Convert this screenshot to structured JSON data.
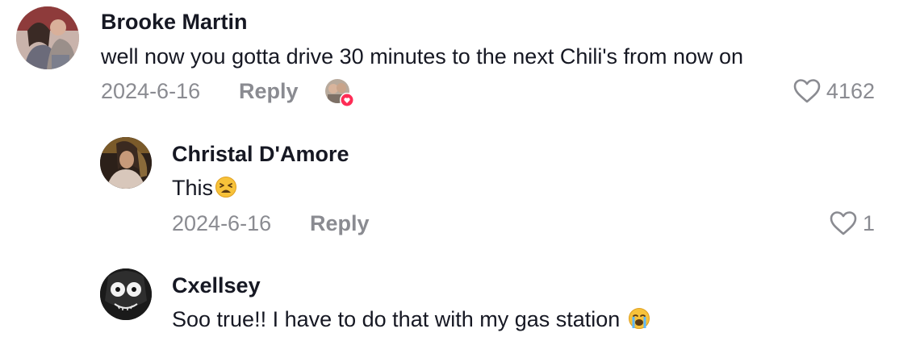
{
  "comments": [
    {
      "username": "Brooke Martin",
      "text": "well now you gotta drive 30 minutes to the next Chili's from now on",
      "date": "2024-6-16",
      "reply_label": "Reply",
      "likes": "4162"
    },
    {
      "username": "Christal D'Amore",
      "text": "This",
      "date": "2024-6-16",
      "reply_label": "Reply",
      "likes": "1"
    },
    {
      "username": "Cxellsey",
      "text": "Soo true!! I have to do that with my gas station",
      "emoji": "crying-face"
    }
  ],
  "colors": {
    "text": "#161823",
    "secondary": "#8a8b91",
    "creator_heart_badge": "#fe2c55",
    "heart_outline": "#8a8b91"
  },
  "icons": {
    "like": "heart-outline-icon",
    "creator_liked": "creator-liked-avatar-with-heart-icon"
  }
}
